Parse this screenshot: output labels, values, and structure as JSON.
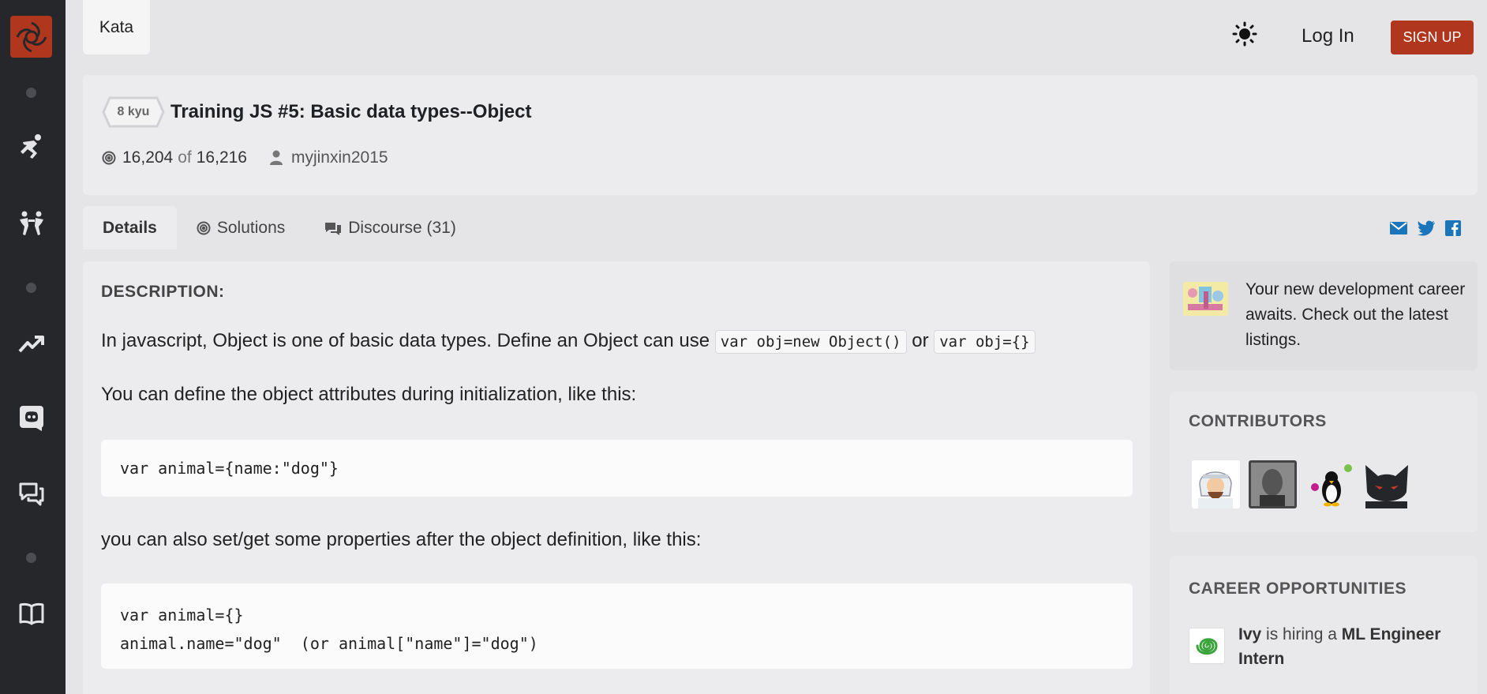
{
  "topbar": {
    "kata_tab": "Kata",
    "login": "Log In",
    "signup": "SIGN UP"
  },
  "kata": {
    "rank": "8 kyu",
    "title": "Training JS #5: Basic data types--Object",
    "completed": "16,204",
    "of_label": "of",
    "attempted": "16,216",
    "author": "myjinxin2015"
  },
  "tabs": [
    {
      "label": "Details",
      "active": true
    },
    {
      "label": "Solutions",
      "active": false
    },
    {
      "label": "Discourse (31)",
      "active": false
    }
  ],
  "description": {
    "heading": "DESCRIPTION:",
    "p1_text": "In javascript, Object is one of basic data types. Define an Object can use",
    "p1_code1": "var obj=new Object()",
    "p1_or": "or",
    "p1_code2": "var obj={}",
    "p2": "You can define the object attributes during initialization, like this:",
    "code1": "var animal={name:\"dog\"}",
    "p3": "you can also set/get some properties after the object definition, like this:",
    "code2_line1": "var animal={}",
    "code2_line2": "animal.name=\"dog\"  (or animal[\"name\"]=\"dog\")"
  },
  "ad": {
    "text": "Your new development career awaits. Check out the latest listings."
  },
  "contributors": {
    "heading": "CONTRIBUTORS"
  },
  "careers": {
    "heading": "CAREER OPPORTUNITIES",
    "job1_company": "Ivy",
    "job1_mid": "is hiring a",
    "job1_role": "ML Engineer Intern"
  },
  "colors": {
    "brand": "#b1361e",
    "sidebar": "#26272b",
    "share_blue": "#1b75bb"
  }
}
